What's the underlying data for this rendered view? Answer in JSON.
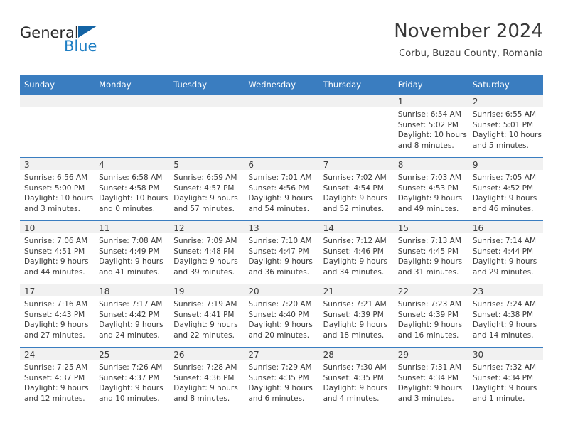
{
  "brand": {
    "word_one": "General",
    "word_two": "Blue",
    "logo_icon": "triangle-logo-icon",
    "accent_color": "#1464a5",
    "blue_text_color": "#1f7fc4"
  },
  "header": {
    "title": "November 2024",
    "subtitle": "Corbu, Buzau County, Romania"
  },
  "theme": {
    "header_row_bg": "#3a7dc0",
    "daynum_band_bg": "#f1f1f1",
    "text_color": "#3a3a3a"
  },
  "calendar": {
    "weekday_headers": [
      "Sunday",
      "Monday",
      "Tuesday",
      "Wednesday",
      "Thursday",
      "Friday",
      "Saturday"
    ],
    "weeks": [
      [
        {
          "day": "",
          "empty": true
        },
        {
          "day": "",
          "empty": true
        },
        {
          "day": "",
          "empty": true
        },
        {
          "day": "",
          "empty": true
        },
        {
          "day": "",
          "empty": true
        },
        {
          "day": "1",
          "sunrise": "Sunrise: 6:54 AM",
          "sunset": "Sunset: 5:02 PM",
          "daylight_line1": "Daylight: 10 hours",
          "daylight_line2": "and 8 minutes."
        },
        {
          "day": "2",
          "sunrise": "Sunrise: 6:55 AM",
          "sunset": "Sunset: 5:01 PM",
          "daylight_line1": "Daylight: 10 hours",
          "daylight_line2": "and 5 minutes."
        }
      ],
      [
        {
          "day": "3",
          "sunrise": "Sunrise: 6:56 AM",
          "sunset": "Sunset: 5:00 PM",
          "daylight_line1": "Daylight: 10 hours",
          "daylight_line2": "and 3 minutes."
        },
        {
          "day": "4",
          "sunrise": "Sunrise: 6:58 AM",
          "sunset": "Sunset: 4:58 PM",
          "daylight_line1": "Daylight: 10 hours",
          "daylight_line2": "and 0 minutes."
        },
        {
          "day": "5",
          "sunrise": "Sunrise: 6:59 AM",
          "sunset": "Sunset: 4:57 PM",
          "daylight_line1": "Daylight: 9 hours",
          "daylight_line2": "and 57 minutes."
        },
        {
          "day": "6",
          "sunrise": "Sunrise: 7:01 AM",
          "sunset": "Sunset: 4:56 PM",
          "daylight_line1": "Daylight: 9 hours",
          "daylight_line2": "and 54 minutes."
        },
        {
          "day": "7",
          "sunrise": "Sunrise: 7:02 AM",
          "sunset": "Sunset: 4:54 PM",
          "daylight_line1": "Daylight: 9 hours",
          "daylight_line2": "and 52 minutes."
        },
        {
          "day": "8",
          "sunrise": "Sunrise: 7:03 AM",
          "sunset": "Sunset: 4:53 PM",
          "daylight_line1": "Daylight: 9 hours",
          "daylight_line2": "and 49 minutes."
        },
        {
          "day": "9",
          "sunrise": "Sunrise: 7:05 AM",
          "sunset": "Sunset: 4:52 PM",
          "daylight_line1": "Daylight: 9 hours",
          "daylight_line2": "and 46 minutes."
        }
      ],
      [
        {
          "day": "10",
          "sunrise": "Sunrise: 7:06 AM",
          "sunset": "Sunset: 4:51 PM",
          "daylight_line1": "Daylight: 9 hours",
          "daylight_line2": "and 44 minutes."
        },
        {
          "day": "11",
          "sunrise": "Sunrise: 7:08 AM",
          "sunset": "Sunset: 4:49 PM",
          "daylight_line1": "Daylight: 9 hours",
          "daylight_line2": "and 41 minutes."
        },
        {
          "day": "12",
          "sunrise": "Sunrise: 7:09 AM",
          "sunset": "Sunset: 4:48 PM",
          "daylight_line1": "Daylight: 9 hours",
          "daylight_line2": "and 39 minutes."
        },
        {
          "day": "13",
          "sunrise": "Sunrise: 7:10 AM",
          "sunset": "Sunset: 4:47 PM",
          "daylight_line1": "Daylight: 9 hours",
          "daylight_line2": "and 36 minutes."
        },
        {
          "day": "14",
          "sunrise": "Sunrise: 7:12 AM",
          "sunset": "Sunset: 4:46 PM",
          "daylight_line1": "Daylight: 9 hours",
          "daylight_line2": "and 34 minutes."
        },
        {
          "day": "15",
          "sunrise": "Sunrise: 7:13 AM",
          "sunset": "Sunset: 4:45 PM",
          "daylight_line1": "Daylight: 9 hours",
          "daylight_line2": "and 31 minutes."
        },
        {
          "day": "16",
          "sunrise": "Sunrise: 7:14 AM",
          "sunset": "Sunset: 4:44 PM",
          "daylight_line1": "Daylight: 9 hours",
          "daylight_line2": "and 29 minutes."
        }
      ],
      [
        {
          "day": "17",
          "sunrise": "Sunrise: 7:16 AM",
          "sunset": "Sunset: 4:43 PM",
          "daylight_line1": "Daylight: 9 hours",
          "daylight_line2": "and 27 minutes."
        },
        {
          "day": "18",
          "sunrise": "Sunrise: 7:17 AM",
          "sunset": "Sunset: 4:42 PM",
          "daylight_line1": "Daylight: 9 hours",
          "daylight_line2": "and 24 minutes."
        },
        {
          "day": "19",
          "sunrise": "Sunrise: 7:19 AM",
          "sunset": "Sunset: 4:41 PM",
          "daylight_line1": "Daylight: 9 hours",
          "daylight_line2": "and 22 minutes."
        },
        {
          "day": "20",
          "sunrise": "Sunrise: 7:20 AM",
          "sunset": "Sunset: 4:40 PM",
          "daylight_line1": "Daylight: 9 hours",
          "daylight_line2": "and 20 minutes."
        },
        {
          "day": "21",
          "sunrise": "Sunrise: 7:21 AM",
          "sunset": "Sunset: 4:39 PM",
          "daylight_line1": "Daylight: 9 hours",
          "daylight_line2": "and 18 minutes."
        },
        {
          "day": "22",
          "sunrise": "Sunrise: 7:23 AM",
          "sunset": "Sunset: 4:39 PM",
          "daylight_line1": "Daylight: 9 hours",
          "daylight_line2": "and 16 minutes."
        },
        {
          "day": "23",
          "sunrise": "Sunrise: 7:24 AM",
          "sunset": "Sunset: 4:38 PM",
          "daylight_line1": "Daylight: 9 hours",
          "daylight_line2": "and 14 minutes."
        }
      ],
      [
        {
          "day": "24",
          "sunrise": "Sunrise: 7:25 AM",
          "sunset": "Sunset: 4:37 PM",
          "daylight_line1": "Daylight: 9 hours",
          "daylight_line2": "and 12 minutes."
        },
        {
          "day": "25",
          "sunrise": "Sunrise: 7:26 AM",
          "sunset": "Sunset: 4:37 PM",
          "daylight_line1": "Daylight: 9 hours",
          "daylight_line2": "and 10 minutes."
        },
        {
          "day": "26",
          "sunrise": "Sunrise: 7:28 AM",
          "sunset": "Sunset: 4:36 PM",
          "daylight_line1": "Daylight: 9 hours",
          "daylight_line2": "and 8 minutes."
        },
        {
          "day": "27",
          "sunrise": "Sunrise: 7:29 AM",
          "sunset": "Sunset: 4:35 PM",
          "daylight_line1": "Daylight: 9 hours",
          "daylight_line2": "and 6 minutes."
        },
        {
          "day": "28",
          "sunrise": "Sunrise: 7:30 AM",
          "sunset": "Sunset: 4:35 PM",
          "daylight_line1": "Daylight: 9 hours",
          "daylight_line2": "and 4 minutes."
        },
        {
          "day": "29",
          "sunrise": "Sunrise: 7:31 AM",
          "sunset": "Sunset: 4:34 PM",
          "daylight_line1": "Daylight: 9 hours",
          "daylight_line2": "and 3 minutes."
        },
        {
          "day": "30",
          "sunrise": "Sunrise: 7:32 AM",
          "sunset": "Sunset: 4:34 PM",
          "daylight_line1": "Daylight: 9 hours",
          "daylight_line2": "and 1 minute."
        }
      ]
    ]
  }
}
